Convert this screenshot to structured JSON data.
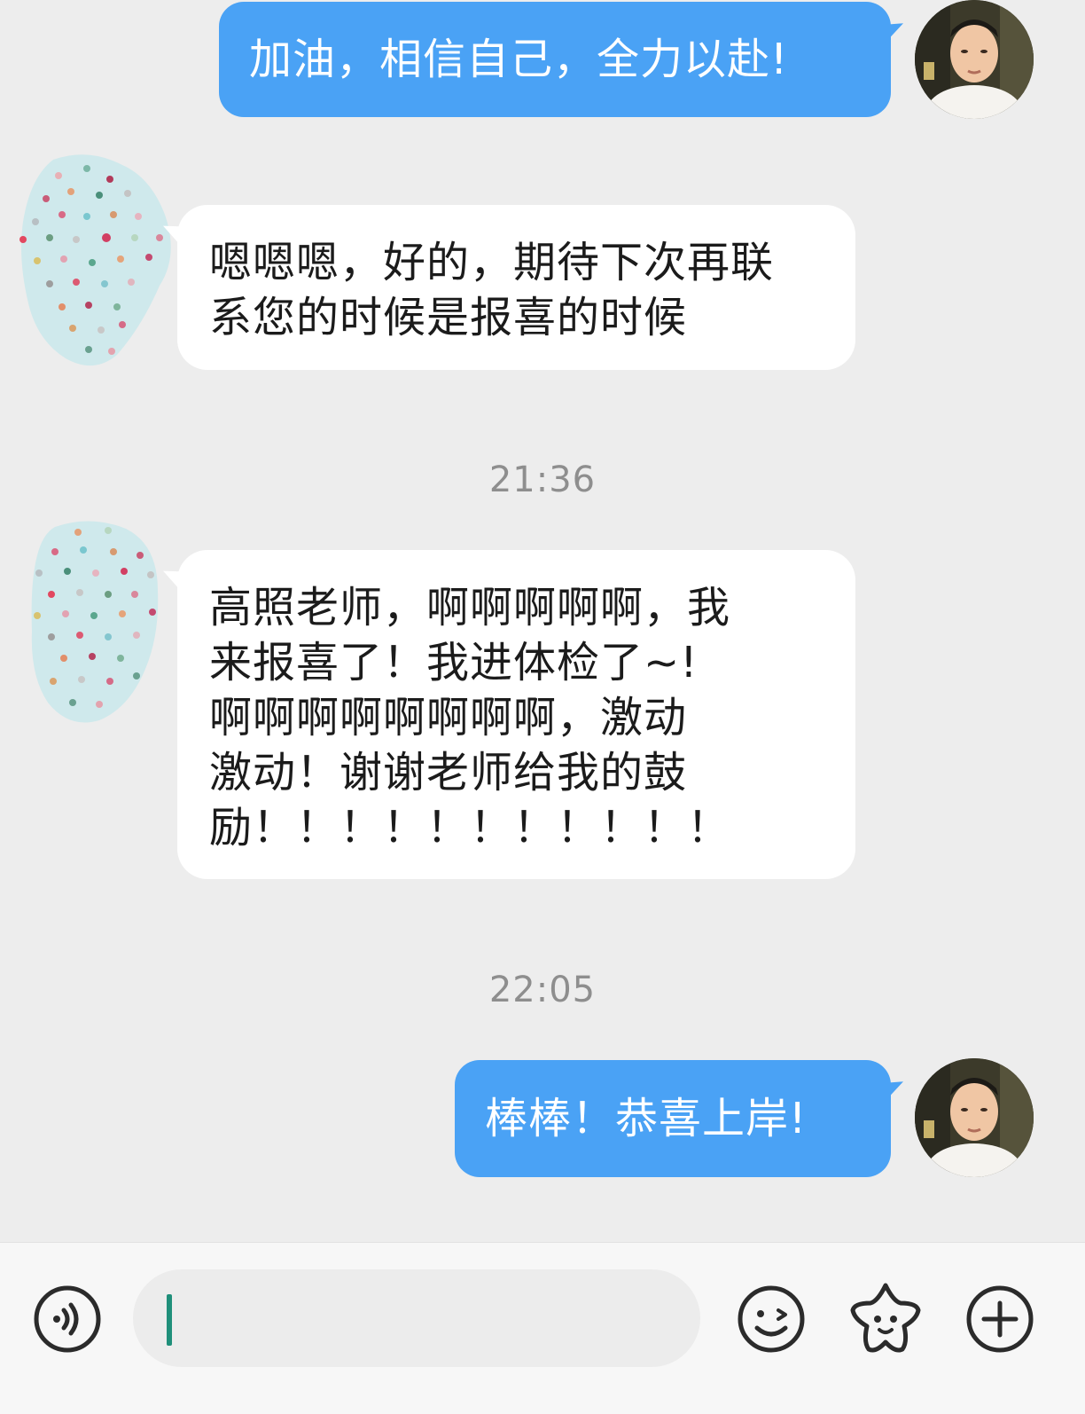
{
  "conversation": {
    "messages": [
      {
        "direction": "outgoing",
        "text": "加油，相信自己，全力以赴!"
      },
      {
        "direction": "incoming",
        "text": "嗯嗯嗯，好的，期待下次再联\n系您的时候是报喜的时候"
      },
      {
        "direction": "incoming",
        "text": "高照老师，啊啊啊啊啊，我\n来报喜了！我进体检了~!\n啊啊啊啊啊啊啊啊，激动\n激动！谢谢老师给我的鼓\n励！！！！！！！！！！！"
      },
      {
        "direction": "outgoing",
        "text": "棒棒！恭喜上岸!"
      }
    ],
    "timestamps": [
      "21:36",
      "22:05"
    ]
  },
  "input_bar": {
    "text_value": "",
    "icons": [
      "voice-icon",
      "emoji-icon",
      "sticker-icon",
      "plus-icon"
    ]
  },
  "colors": {
    "outgoing_bubble": "#4aa2f5",
    "incoming_bubble": "#ffffff",
    "background": "#ededed",
    "caret": "#1f8f7a"
  }
}
